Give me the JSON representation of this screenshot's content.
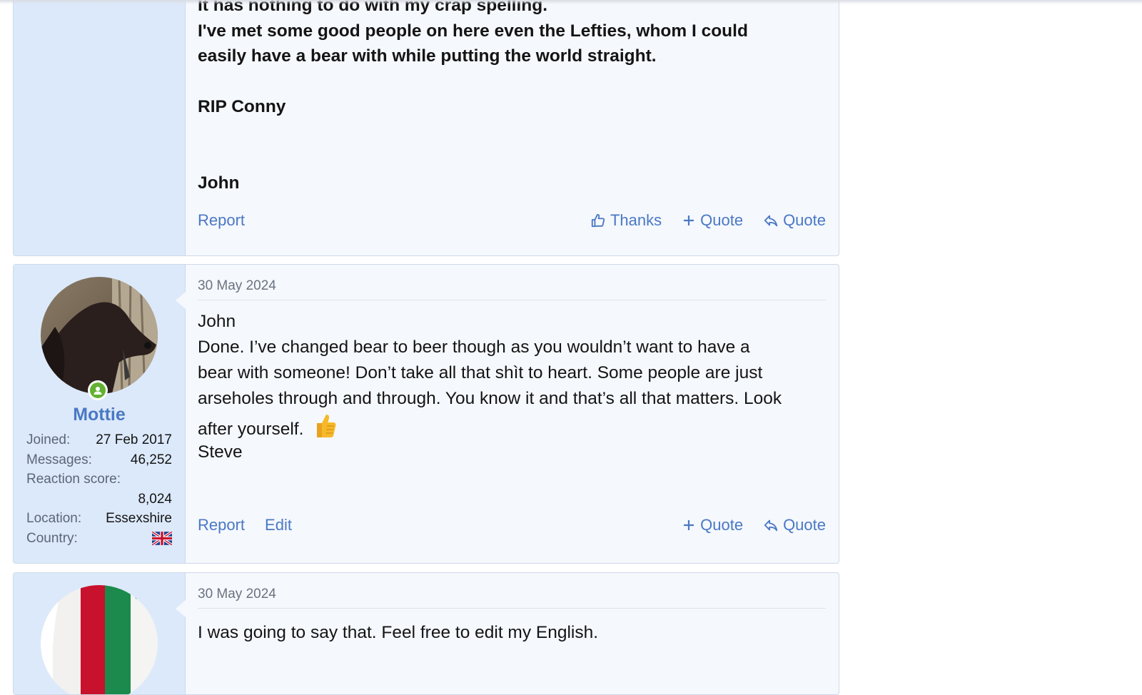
{
  "posts": [
    {
      "body_lines": [
        "It has nothing to do with my crap spelling.",
        "I've met some good people on here even the Lefties, whom I could",
        "easily have a bear with while putting the world straight.",
        "",
        "RIP Conny",
        "",
        "",
        "John"
      ],
      "actions": {
        "report": "Report",
        "thanks": "Thanks",
        "quote_plus": "Quote",
        "quote_reply": "Quote"
      }
    },
    {
      "date": "30 May 2024",
      "user": {
        "name": "Mottie",
        "joined_label": "Joined:",
        "joined": "27 Feb 2017",
        "messages_label": "Messages:",
        "messages": "46,252",
        "reaction_label": "Reaction score:",
        "reaction": "8,024",
        "location_label": "Location:",
        "location": "Essexshire",
        "country_label": "Country:",
        "country_flag": "uk-flag-icon"
      },
      "body_lines": [
        "John",
        "Done. I’ve changed bear to beer though as you wouldn’t want to have a",
        "bear with someone! Don’t take all that shìt to heart. Some people are just",
        "arseholes through and through. You know it and that’s all that matters. Look",
        "after yourself.",
        "Steve"
      ],
      "actions": {
        "report": "Report",
        "edit": "Edit",
        "quote_plus": "Quote",
        "quote_reply": "Quote"
      }
    },
    {
      "date": "30 May 2024",
      "body_lines": [
        "I was going to say that. Feel free to edit my English."
      ]
    }
  ],
  "colors": {
    "link": "#4a78c4",
    "sidebar": "#dce9fa",
    "post_bg": "#f5f8fd",
    "online": "#63b132"
  }
}
